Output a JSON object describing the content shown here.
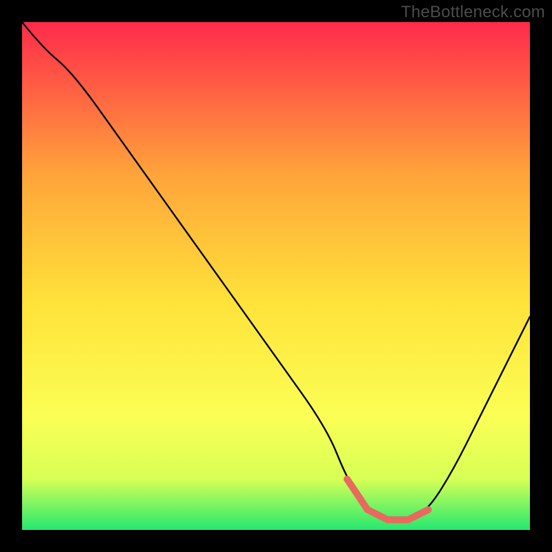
{
  "watermark": "TheBottleneck.com",
  "colors": {
    "background": "#000000",
    "watermark": "#4c4c4c",
    "curve": "#000000",
    "highlight": "#e86a5e",
    "gradient_top": "#ff2a4b",
    "gradient_mid_upper": "#ffa43a",
    "gradient_mid": "#ffe23a",
    "gradient_mid_lower": "#fbff55",
    "gradient_lower": "#d7ff55",
    "gradient_bottom": "#25e86f"
  },
  "chart_data": {
    "type": "line",
    "title": "",
    "xlabel": "",
    "ylabel": "",
    "xlim": [
      0,
      100
    ],
    "ylim": [
      0,
      100
    ],
    "x": [
      0,
      4,
      10,
      20,
      30,
      40,
      50,
      60,
      64,
      68,
      72,
      76,
      80,
      85,
      90,
      95,
      100
    ],
    "values": [
      100,
      95,
      90,
      76,
      62,
      48,
      34,
      20,
      10,
      4,
      2,
      2,
      4,
      12,
      22,
      32,
      42
    ],
    "highlight_segment": {
      "x_start": 64,
      "x_end": 80,
      "note": "flat trough region emphasized in red"
    },
    "background_gradient_axis": "y",
    "background_gradient_meaning": "red=high bottleneck, green=low bottleneck"
  }
}
